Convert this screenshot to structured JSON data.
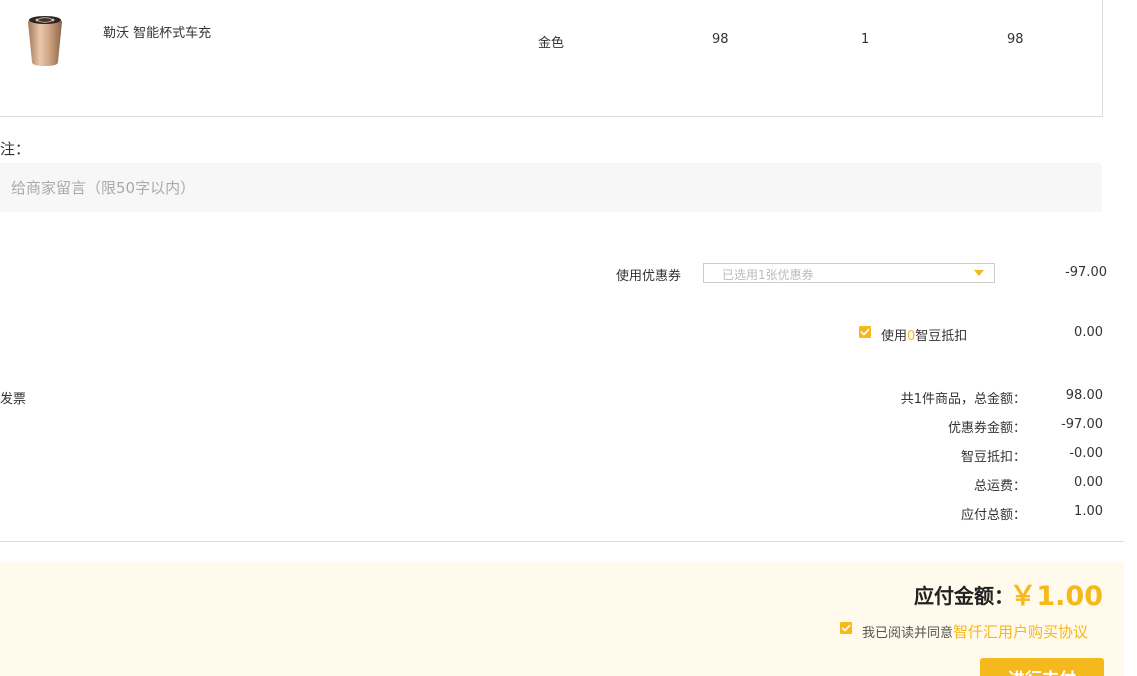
{
  "product": {
    "name": "勒沃 智能杯式车充",
    "color": "金色",
    "price": "98",
    "quantity": "1",
    "subtotal": "98"
  },
  "remark": {
    "label": "注：",
    "placeholder": "给商家留言（限50字以内）"
  },
  "coupon": {
    "label": "使用优惠券",
    "selected": "已选用1张优惠券",
    "amount": "-97.00"
  },
  "zhidou": {
    "label_prefix": "使用",
    "count": "0",
    "label_suffix": "智豆抵扣",
    "amount": "0.00"
  },
  "invoice": {
    "label": "发票"
  },
  "summary": {
    "rows": [
      {
        "label": "共1件商品，总金额：",
        "value": "98.00"
      },
      {
        "label": "优惠券金额：",
        "value": "-97.00"
      },
      {
        "label": "智豆抵扣：",
        "value": "-0.00"
      },
      {
        "label": "总运费：",
        "value": "0.00"
      },
      {
        "label": "应付总额：",
        "value": "1.00"
      }
    ]
  },
  "payment": {
    "label": "应付金额：",
    "amount": "￥1.00",
    "agree_text": "我已阅读并同意",
    "agreement_link": "智仟汇用户购买协议",
    "button_label": "进行支付"
  },
  "colors": {
    "accent": "#f5b81d",
    "band": "#fffaeb"
  }
}
